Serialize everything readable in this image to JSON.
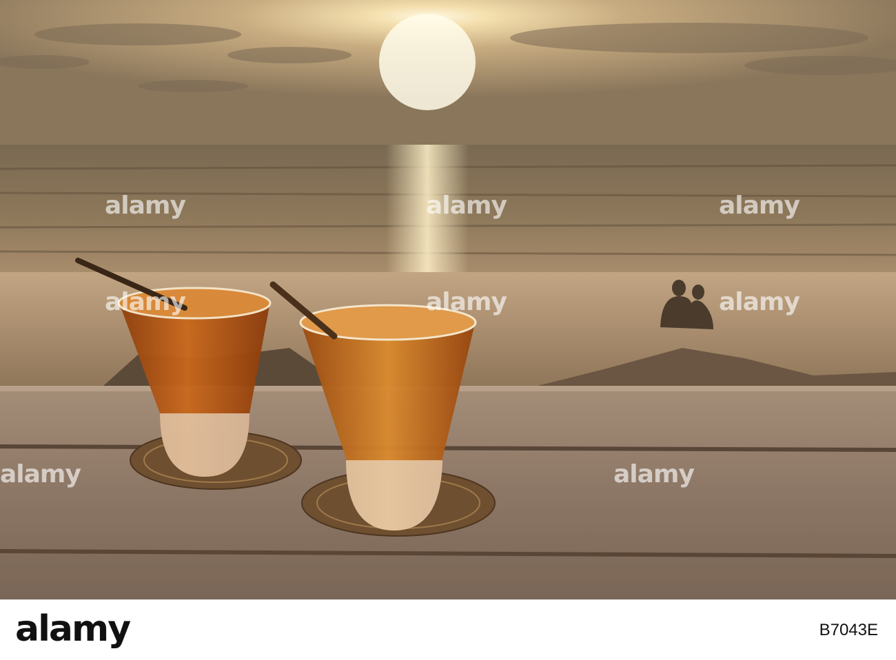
{
  "image": {
    "subject": "two-cocktails-on-beach-table-at-sunset",
    "colors": {
      "sky_top": "#8d7a5f",
      "sun": "#fff6d8",
      "sea": "#6f5d45",
      "sand": "#b79a7a",
      "table": "#8d7766",
      "drink": "#b55a14"
    }
  },
  "watermark": {
    "text": "alamy"
  },
  "footer": {
    "logo": "alamy",
    "image_id": "B7043E"
  }
}
